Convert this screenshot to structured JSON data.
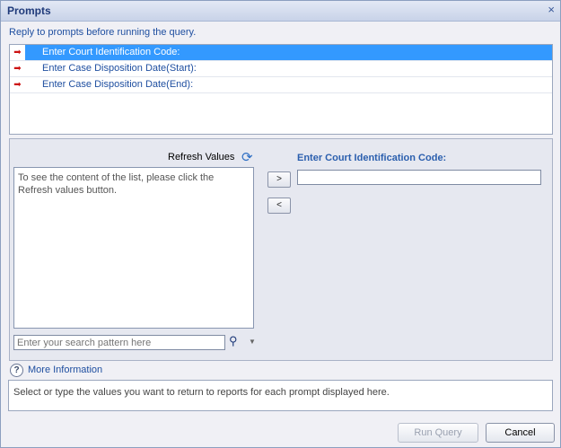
{
  "window": {
    "title": "Prompts",
    "close_glyph": "×"
  },
  "subtitle": "Reply to prompts before running the query.",
  "prompts": [
    {
      "label": "Enter Court Identification Code:",
      "selected": true
    },
    {
      "label": "Enter Case Disposition Date(Start):",
      "selected": false
    },
    {
      "label": "Enter Case Disposition Date(End):",
      "selected": false
    }
  ],
  "values_panel": {
    "refresh_label": "Refresh Values",
    "list_hint": "To see the content of the list, please click the Refresh values button.",
    "search_placeholder": "Enter your search pattern here",
    "add_glyph": ">",
    "remove_glyph": "<"
  },
  "current_prompt": {
    "heading": "Enter Court Identification Code:",
    "value": ""
  },
  "more_info": {
    "label": "More Information",
    "icon_glyph": "?"
  },
  "info_text": "Select or type the values you want to return to reports for each prompt displayed here.",
  "buttons": {
    "run_query": "Run Query",
    "cancel": "Cancel"
  },
  "icons": {
    "prompt_arrow": "arrow-right-icon",
    "refresh": "refresh-icon",
    "search": "binoculars-icon",
    "caret": "chevron-down-icon"
  },
  "colors": {
    "selection": "#3399ff",
    "link": "#1f4fa0",
    "arrow": "#cc1111"
  }
}
